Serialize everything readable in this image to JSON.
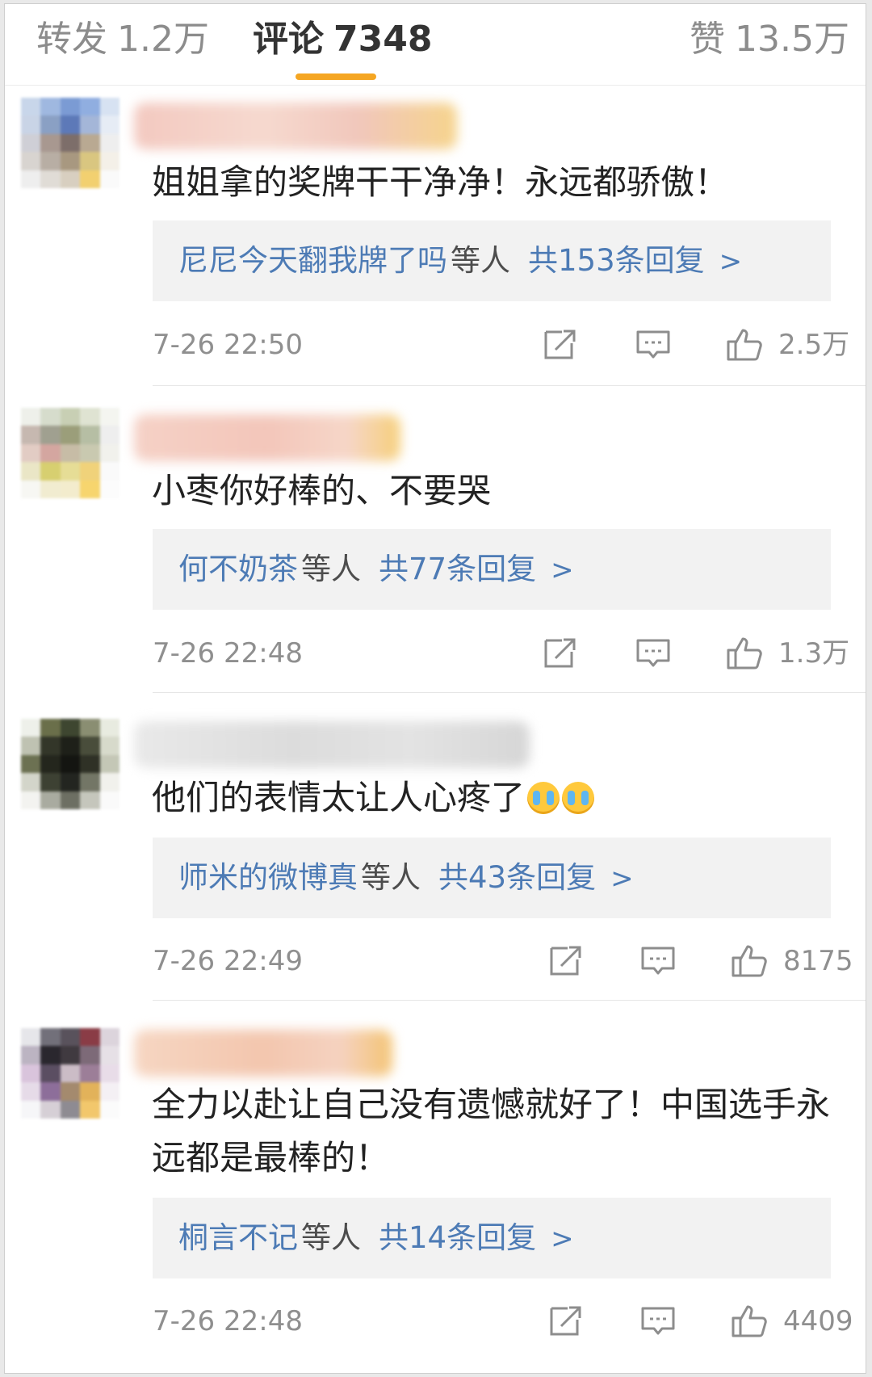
{
  "tabs": {
    "repost": {
      "label": "转发",
      "count": "1.2万"
    },
    "comments": {
      "label": "评论",
      "count": "7348"
    },
    "likes": {
      "label": "赞",
      "count": "13.5万"
    }
  },
  "accent_color": "#f5a623",
  "link_color": "#4d7bb5",
  "comments": [
    {
      "text": "姐姐拿的奖牌干干净净！永远都骄傲！",
      "reply_names": "尼尼今天翻我牌了吗",
      "reply_suffix": "等人",
      "reply_total": "共153条回复",
      "time": "7-26 22:50",
      "likes": "2.5万"
    },
    {
      "text": "小枣你好棒的、不要哭",
      "reply_names": "何不奶茶",
      "reply_suffix": "等人",
      "reply_total": "共77条回复",
      "time": "7-26 22:48",
      "likes": "1.3万"
    },
    {
      "text": "他们的表情太让人心疼了",
      "emoji": "crying-face",
      "reply_names": "师米的微博真",
      "reply_suffix": "等人",
      "reply_total": "共43条回复",
      "time": "7-26 22:49",
      "likes": "8175"
    },
    {
      "text": "全力以赴让自己没有遗憾就好了！中国选手永远都是最棒的！",
      "reply_names": "桐言不记",
      "reply_suffix": "等人",
      "reply_total": "共14条回复",
      "time": "7-26 22:48",
      "likes": "4409"
    }
  ],
  "icons": {
    "repost": "share-icon",
    "comment": "comment-icon",
    "like": "thumbs-up-icon",
    "more": "chevron-right-icon"
  }
}
